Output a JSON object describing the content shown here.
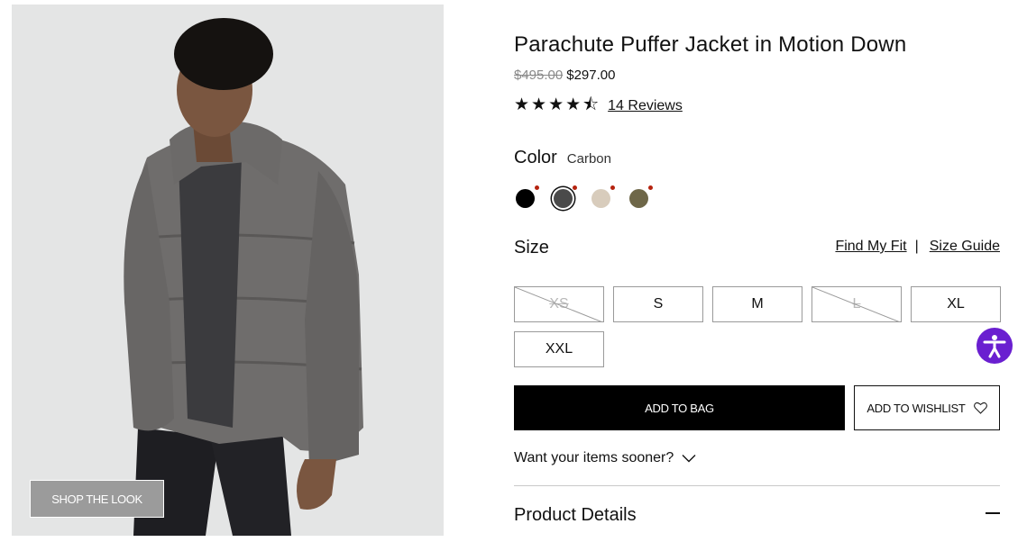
{
  "product": {
    "title": "Parachute Puffer Jacket in Motion Down",
    "original_price": "$495.00",
    "sale_price": "$297.00",
    "rating_stars": "★★★★⯪",
    "rating_value": 4.5,
    "reviews_label": "14 Reviews"
  },
  "image": {
    "shop_the_look_label": "SHOP THE LOOK"
  },
  "color": {
    "label": "Color",
    "selected_name": "Carbon",
    "swatches": [
      {
        "name": "black",
        "hex": "#000000",
        "selected": false
      },
      {
        "name": "carbon",
        "hex": "#4a4a4a",
        "selected": true
      },
      {
        "name": "beige",
        "hex": "#d8ccbc",
        "selected": false
      },
      {
        "name": "olive",
        "hex": "#6e6748",
        "selected": false
      }
    ],
    "swatch_dot_color": "#b5230f"
  },
  "size": {
    "label": "Size",
    "find_fit_label": "Find My Fit",
    "separator": "|",
    "size_guide_label": "Size Guide",
    "options": [
      {
        "label": "XS",
        "available": false
      },
      {
        "label": "S",
        "available": true
      },
      {
        "label": "M",
        "available": true
      },
      {
        "label": "L",
        "available": false
      },
      {
        "label": "XL",
        "available": true
      },
      {
        "label": "XXL",
        "available": true
      }
    ]
  },
  "actions": {
    "add_to_bag_label": "ADD TO BAG",
    "add_to_wishlist_label": "ADD TO WISHLIST"
  },
  "shipping": {
    "sooner_label": "Want your items sooner?"
  },
  "sections": {
    "product_details_label": "Product Details"
  },
  "colors": {
    "accessibility_button": "#6a1fd0",
    "primary_button": "#000000"
  }
}
